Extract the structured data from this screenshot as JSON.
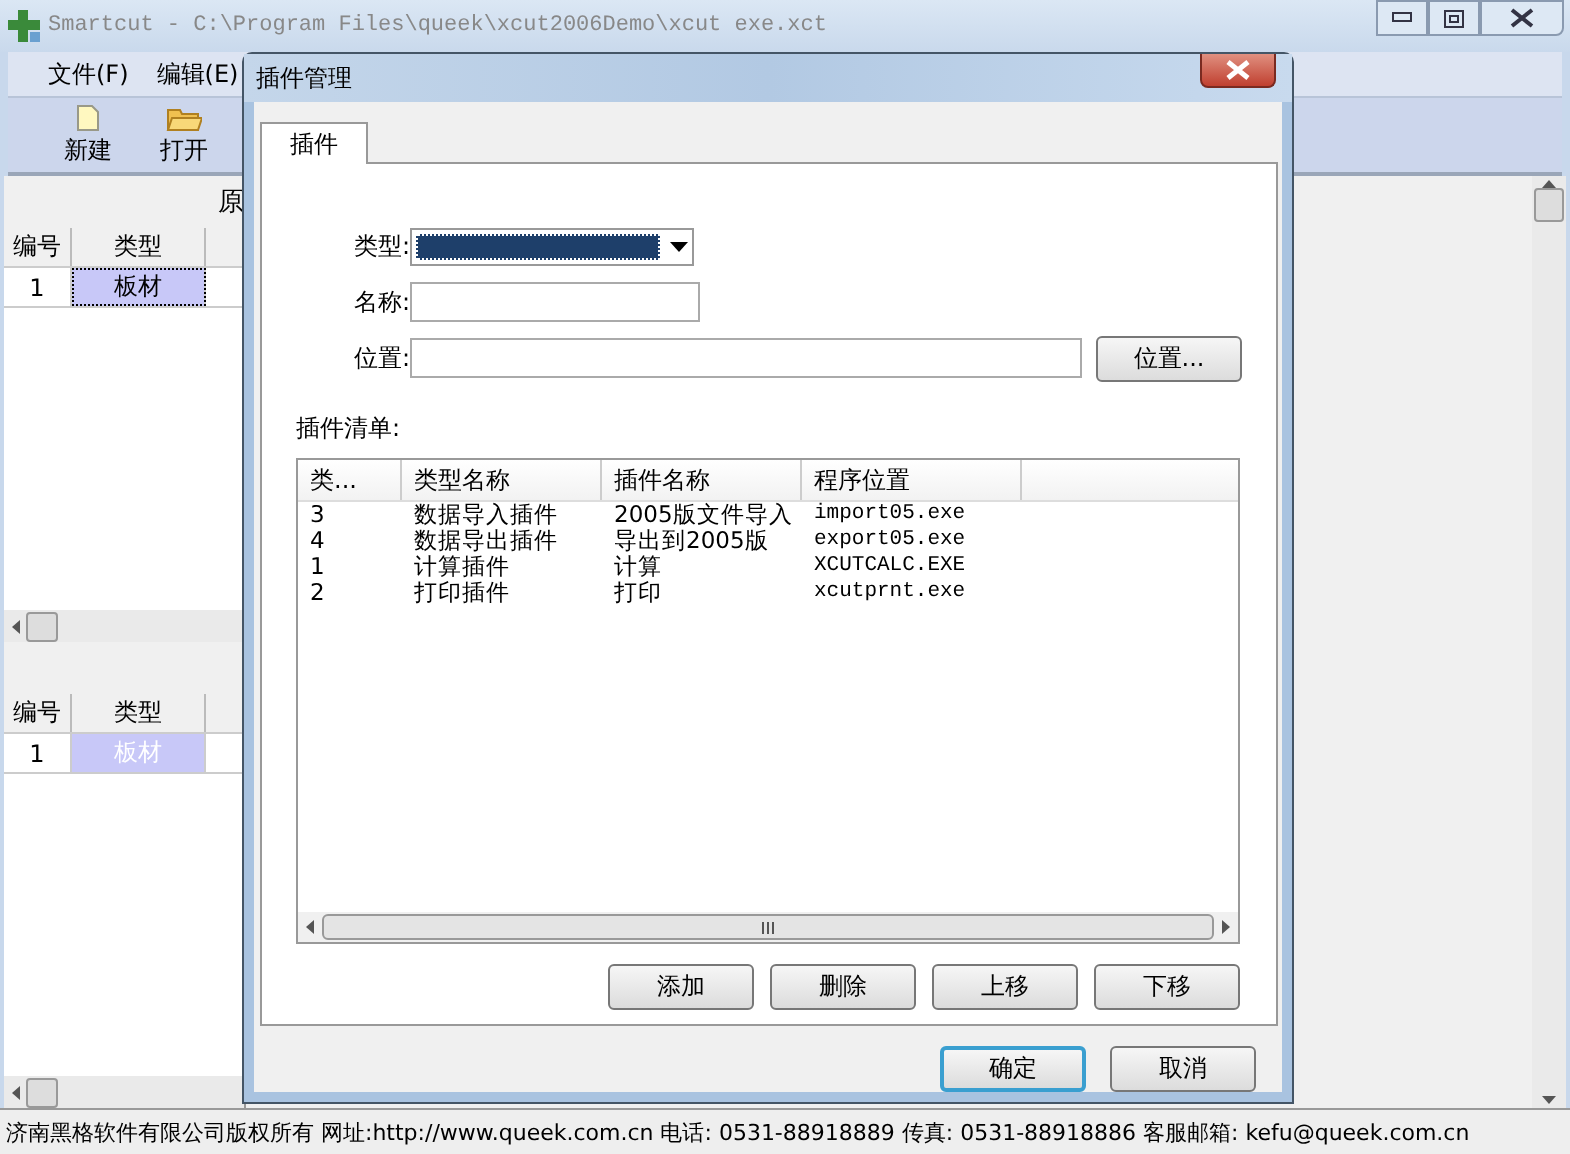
{
  "window": {
    "title": "Smartcut - C:\\Program Files\\queek\\xcut2006Demo\\xcut exe.xct"
  },
  "menu": [
    "文件(F)",
    "编辑(E)"
  ],
  "toolbar": [
    {
      "label": "新建",
      "kind": "new"
    },
    {
      "label": "打开",
      "kind": "open"
    }
  ],
  "left_panels": [
    {
      "heading": "原",
      "columns": [
        "编号",
        "类型"
      ],
      "rows": [
        {
          "cells": [
            "1",
            "板材"
          ],
          "selected": true,
          "focused": true
        }
      ]
    },
    {
      "columns": [
        "编号",
        "类型"
      ],
      "rows": [
        {
          "cells": [
            "1",
            "板材"
          ],
          "selected": true,
          "focused": false
        }
      ]
    }
  ],
  "dialog": {
    "title": "插件管理",
    "tabs": [
      {
        "label": "插件",
        "selected": true
      }
    ],
    "type_field": {
      "label": "类型:",
      "highlighted": true
    },
    "name_field": {
      "label": "名称:"
    },
    "location_field": {
      "label": "位置:"
    },
    "browse_button": "位置...",
    "list_label": "插件清单:",
    "list": {
      "columns": [
        "类...",
        "类型名称",
        "插件名称",
        "程序位置"
      ],
      "rows": [
        [
          "3",
          "数据导入插件",
          "2005版文件导入",
          "import05.exe"
        ],
        [
          "4",
          "数据导出插件",
          "导出到2005版",
          "export05.exe"
        ],
        [
          "1",
          "计算插件",
          "计算",
          "XCUTCALC.EXE"
        ],
        [
          "2",
          "打印插件",
          "打印",
          "xcutprnt.exe"
        ]
      ]
    },
    "action_buttons": [
      "添加",
      "删除",
      "上移",
      "下移"
    ],
    "buttons": [
      {
        "label": "确定",
        "default": true
      },
      {
        "label": "取消",
        "default": false
      }
    ]
  },
  "status_bar": "济南黑格软件有限公司版权所有 网址:http://www.queek.com.cn  电话: 0531-88918889 传真: 0531-88918886 客服邮箱: kefu@queek.com.cn"
}
